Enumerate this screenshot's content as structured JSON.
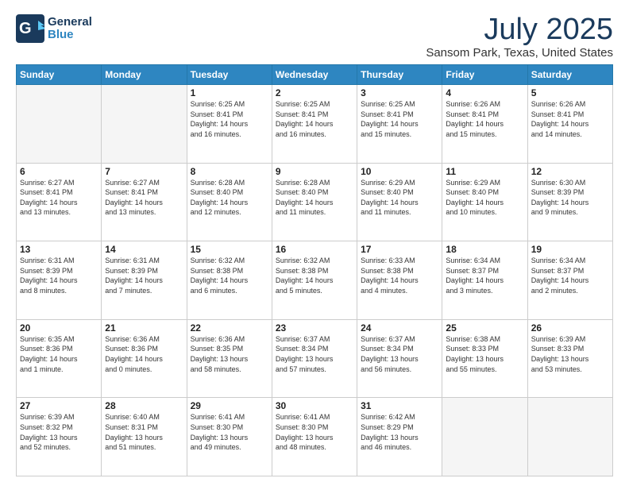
{
  "header": {
    "logo_line1": "General",
    "logo_line2": "Blue",
    "title": "July 2025",
    "subtitle": "Sansom Park, Texas, United States"
  },
  "weekdays": [
    "Sunday",
    "Monday",
    "Tuesday",
    "Wednesday",
    "Thursday",
    "Friday",
    "Saturday"
  ],
  "weeks": [
    [
      {
        "day": "",
        "info": ""
      },
      {
        "day": "",
        "info": ""
      },
      {
        "day": "1",
        "info": "Sunrise: 6:25 AM\nSunset: 8:41 PM\nDaylight: 14 hours\nand 16 minutes."
      },
      {
        "day": "2",
        "info": "Sunrise: 6:25 AM\nSunset: 8:41 PM\nDaylight: 14 hours\nand 16 minutes."
      },
      {
        "day": "3",
        "info": "Sunrise: 6:25 AM\nSunset: 8:41 PM\nDaylight: 14 hours\nand 15 minutes."
      },
      {
        "day": "4",
        "info": "Sunrise: 6:26 AM\nSunset: 8:41 PM\nDaylight: 14 hours\nand 15 minutes."
      },
      {
        "day": "5",
        "info": "Sunrise: 6:26 AM\nSunset: 8:41 PM\nDaylight: 14 hours\nand 14 minutes."
      }
    ],
    [
      {
        "day": "6",
        "info": "Sunrise: 6:27 AM\nSunset: 8:41 PM\nDaylight: 14 hours\nand 13 minutes."
      },
      {
        "day": "7",
        "info": "Sunrise: 6:27 AM\nSunset: 8:41 PM\nDaylight: 14 hours\nand 13 minutes."
      },
      {
        "day": "8",
        "info": "Sunrise: 6:28 AM\nSunset: 8:40 PM\nDaylight: 14 hours\nand 12 minutes."
      },
      {
        "day": "9",
        "info": "Sunrise: 6:28 AM\nSunset: 8:40 PM\nDaylight: 14 hours\nand 11 minutes."
      },
      {
        "day": "10",
        "info": "Sunrise: 6:29 AM\nSunset: 8:40 PM\nDaylight: 14 hours\nand 11 minutes."
      },
      {
        "day": "11",
        "info": "Sunrise: 6:29 AM\nSunset: 8:40 PM\nDaylight: 14 hours\nand 10 minutes."
      },
      {
        "day": "12",
        "info": "Sunrise: 6:30 AM\nSunset: 8:39 PM\nDaylight: 14 hours\nand 9 minutes."
      }
    ],
    [
      {
        "day": "13",
        "info": "Sunrise: 6:31 AM\nSunset: 8:39 PM\nDaylight: 14 hours\nand 8 minutes."
      },
      {
        "day": "14",
        "info": "Sunrise: 6:31 AM\nSunset: 8:39 PM\nDaylight: 14 hours\nand 7 minutes."
      },
      {
        "day": "15",
        "info": "Sunrise: 6:32 AM\nSunset: 8:38 PM\nDaylight: 14 hours\nand 6 minutes."
      },
      {
        "day": "16",
        "info": "Sunrise: 6:32 AM\nSunset: 8:38 PM\nDaylight: 14 hours\nand 5 minutes."
      },
      {
        "day": "17",
        "info": "Sunrise: 6:33 AM\nSunset: 8:38 PM\nDaylight: 14 hours\nand 4 minutes."
      },
      {
        "day": "18",
        "info": "Sunrise: 6:34 AM\nSunset: 8:37 PM\nDaylight: 14 hours\nand 3 minutes."
      },
      {
        "day": "19",
        "info": "Sunrise: 6:34 AM\nSunset: 8:37 PM\nDaylight: 14 hours\nand 2 minutes."
      }
    ],
    [
      {
        "day": "20",
        "info": "Sunrise: 6:35 AM\nSunset: 8:36 PM\nDaylight: 14 hours\nand 1 minute."
      },
      {
        "day": "21",
        "info": "Sunrise: 6:36 AM\nSunset: 8:36 PM\nDaylight: 14 hours\nand 0 minutes."
      },
      {
        "day": "22",
        "info": "Sunrise: 6:36 AM\nSunset: 8:35 PM\nDaylight: 13 hours\nand 58 minutes."
      },
      {
        "day": "23",
        "info": "Sunrise: 6:37 AM\nSunset: 8:34 PM\nDaylight: 13 hours\nand 57 minutes."
      },
      {
        "day": "24",
        "info": "Sunrise: 6:37 AM\nSunset: 8:34 PM\nDaylight: 13 hours\nand 56 minutes."
      },
      {
        "day": "25",
        "info": "Sunrise: 6:38 AM\nSunset: 8:33 PM\nDaylight: 13 hours\nand 55 minutes."
      },
      {
        "day": "26",
        "info": "Sunrise: 6:39 AM\nSunset: 8:33 PM\nDaylight: 13 hours\nand 53 minutes."
      }
    ],
    [
      {
        "day": "27",
        "info": "Sunrise: 6:39 AM\nSunset: 8:32 PM\nDaylight: 13 hours\nand 52 minutes."
      },
      {
        "day": "28",
        "info": "Sunrise: 6:40 AM\nSunset: 8:31 PM\nDaylight: 13 hours\nand 51 minutes."
      },
      {
        "day": "29",
        "info": "Sunrise: 6:41 AM\nSunset: 8:30 PM\nDaylight: 13 hours\nand 49 minutes."
      },
      {
        "day": "30",
        "info": "Sunrise: 6:41 AM\nSunset: 8:30 PM\nDaylight: 13 hours\nand 48 minutes."
      },
      {
        "day": "31",
        "info": "Sunrise: 6:42 AM\nSunset: 8:29 PM\nDaylight: 13 hours\nand 46 minutes."
      },
      {
        "day": "",
        "info": ""
      },
      {
        "day": "",
        "info": ""
      }
    ]
  ]
}
